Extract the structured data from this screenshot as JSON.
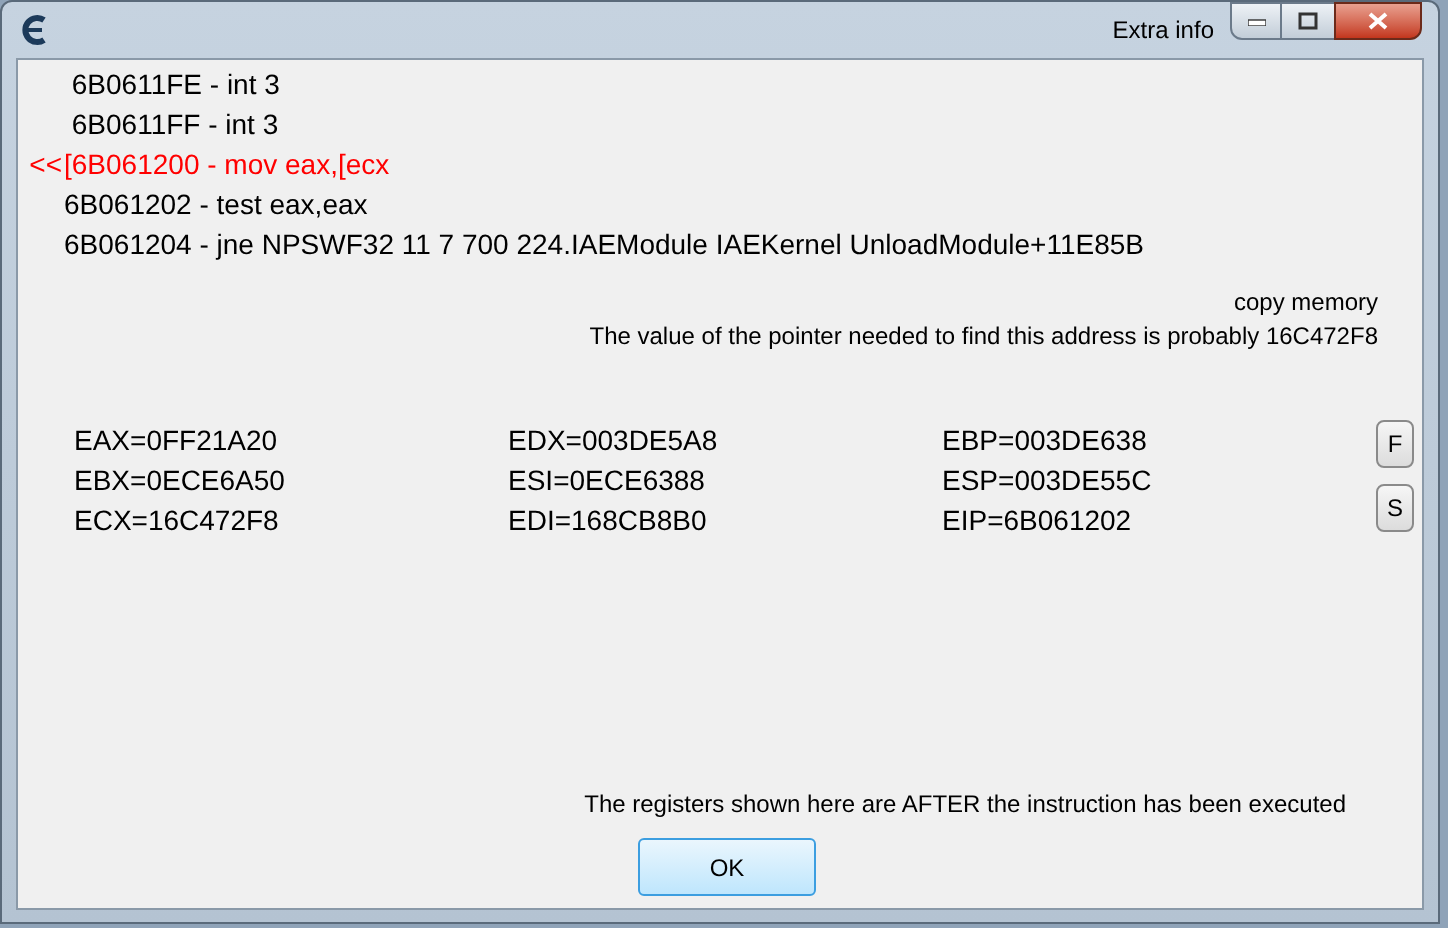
{
  "window": {
    "title": "Extra info"
  },
  "disassembly": [
    {
      "text": " 6B0611FE - int 3",
      "current": false
    },
    {
      "text": " 6B0611FF - int 3",
      "current": false
    },
    {
      "text": "[6B061200 - mov eax,[ecx",
      "current": true,
      "marker": "<<"
    },
    {
      "text": "6B061202 - test eax,eax",
      "current": false
    },
    {
      "text": "6B061204 - jne NPSWF32 11 7 700 224.IAEModule IAEKernel UnloadModule+11E85B",
      "current": false
    }
  ],
  "copy_memory": "copy memory",
  "pointer_note": "The value of the pointer needed to find this address is probably 16C472F8",
  "registers": [
    [
      "EAX=0FF21A20",
      "EBX=0ECE6A50",
      "ECX=16C472F8"
    ],
    [
      "EDX=003DE5A8",
      "ESI=0ECE6388",
      "EDI=168CB8B0"
    ],
    [
      "EBP=003DE638",
      "ESP=003DE55C",
      "EIP=6B061202"
    ]
  ],
  "side_buttons": [
    "F",
    "S"
  ],
  "footer_note": "The registers shown here are AFTER the instruction has been executed",
  "ok_button": "OK"
}
